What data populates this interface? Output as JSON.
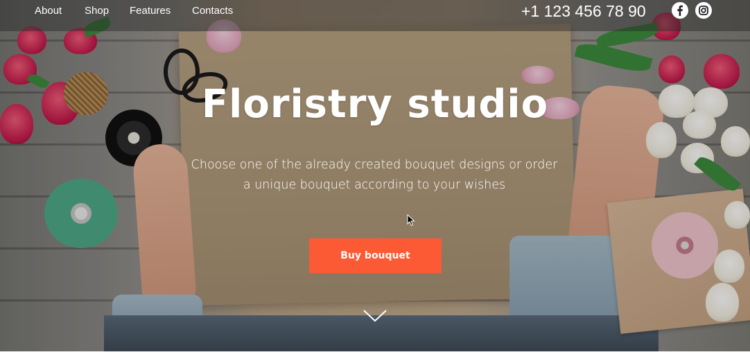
{
  "nav": {
    "links": [
      {
        "label": "About"
      },
      {
        "label": "Shop"
      },
      {
        "label": "Features"
      },
      {
        "label": "Contacts"
      }
    ],
    "phone": "+1 123 456 78 90",
    "social_icons": [
      "facebook-icon",
      "instagram-icon"
    ]
  },
  "hero": {
    "title": "Floristry studio",
    "subtitle": "Choose one of the already created bouquet designs or order a unique bouquet according to your wishes",
    "button_label": "Buy bouquet",
    "scroll_icon": "chevron-down-icon"
  },
  "colors": {
    "accent": "#fc5a34",
    "nav_text": "#ffffff"
  }
}
